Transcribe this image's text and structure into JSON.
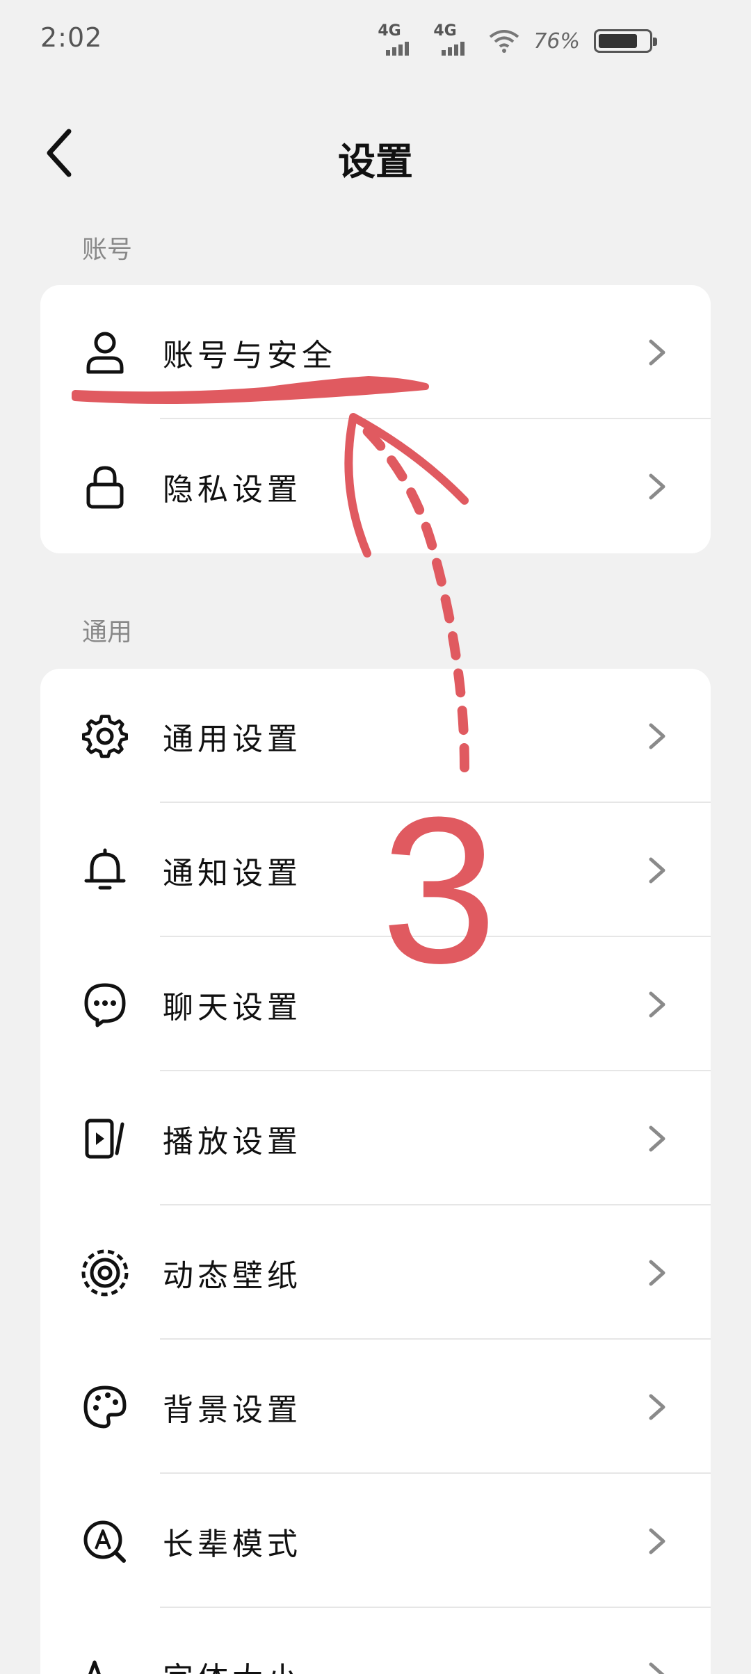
{
  "status_bar": {
    "time": "2:02",
    "signal1": "4G",
    "signal2": "4G",
    "battery_percent": "76%",
    "battery_level": 0.76,
    "icons": [
      "signal-icon",
      "signal-icon",
      "wifi-icon",
      "battery-icon"
    ]
  },
  "header": {
    "title": "设置",
    "back_icon": "chevron-left-icon"
  },
  "sections": {
    "account": {
      "label": "账号",
      "items": [
        {
          "label": "账号与安全",
          "icon": "user-icon"
        },
        {
          "label": "隐私设置",
          "icon": "lock-icon"
        }
      ]
    },
    "general": {
      "label": "通用",
      "items": [
        {
          "label": "通用设置",
          "icon": "gear-icon"
        },
        {
          "label": "通知设置",
          "icon": "bell-icon"
        },
        {
          "label": "聊天设置",
          "icon": "chat-bubble-icon"
        },
        {
          "label": "播放设置",
          "icon": "play-icon"
        },
        {
          "label": "动态壁纸",
          "icon": "target-icon"
        },
        {
          "label": "背景设置",
          "icon": "palette-icon"
        },
        {
          "label": "长辈模式",
          "icon": "elder-mode-icon"
        },
        {
          "label": "字体大小",
          "icon": "font-size-icon"
        }
      ]
    }
  },
  "annotation": {
    "step_number": "3",
    "color": "#e05a60"
  },
  "colors": {
    "background": "#f1f1f1",
    "card": "#ffffff",
    "chevron": "#8a8a8a",
    "section_label": "#888888"
  }
}
